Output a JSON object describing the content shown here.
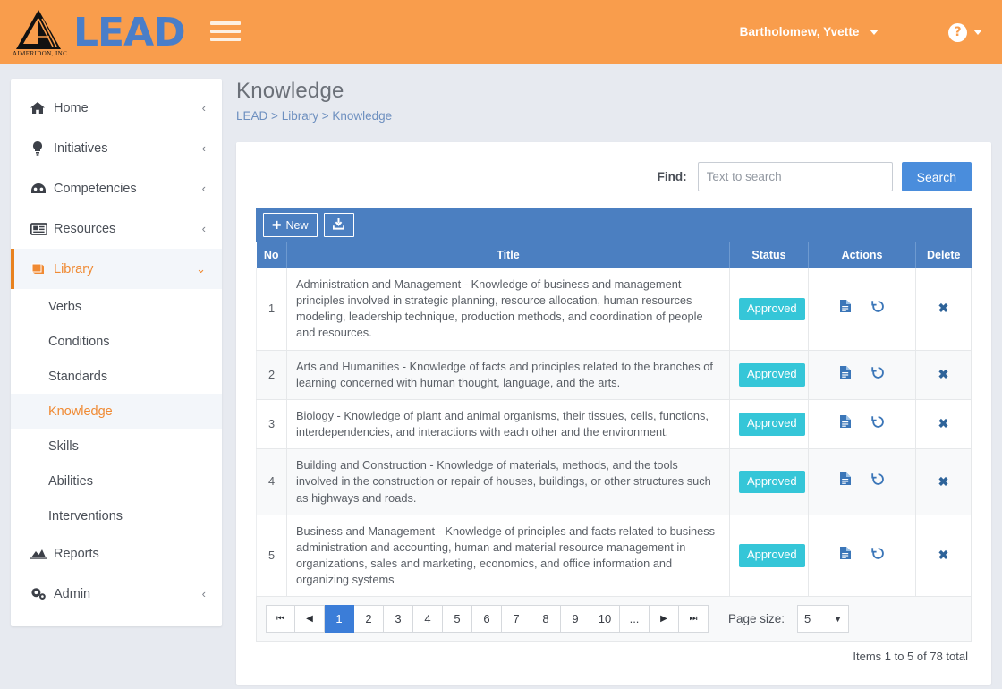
{
  "topbar": {
    "logo_company": "AIMERIDON, INC.",
    "logo_word": "LEAD",
    "menu_icon": "hamburger-icon",
    "user_name": "Bartholomew, Yvette",
    "help_glyph": "?"
  },
  "sidebar": {
    "items": [
      {
        "label": "Home",
        "icon": "home-icon",
        "chev": "‹",
        "active": false
      },
      {
        "label": "Initiatives",
        "icon": "lightbulb-icon",
        "chev": "‹",
        "active": false
      },
      {
        "label": "Competencies",
        "icon": "competency-icon",
        "chev": "‹",
        "active": false
      },
      {
        "label": "Resources",
        "icon": "resources-icon",
        "chev": "‹",
        "active": false
      },
      {
        "label": "Library",
        "icon": "book-icon",
        "chev": "⌄",
        "active": true
      }
    ],
    "sub_items": [
      {
        "label": "Verbs",
        "active": false
      },
      {
        "label": "Conditions",
        "active": false
      },
      {
        "label": "Standards",
        "active": false
      },
      {
        "label": "Knowledge",
        "active": true
      },
      {
        "label": "Skills",
        "active": false
      },
      {
        "label": "Abilities",
        "active": false
      },
      {
        "label": "Interventions",
        "active": false
      }
    ],
    "tail_items": [
      {
        "label": "Reports",
        "icon": "chart-icon",
        "chev": "",
        "active": false
      },
      {
        "label": "Admin",
        "icon": "gears-icon",
        "chev": "‹",
        "active": false
      }
    ]
  },
  "main": {
    "title": "Knowledge",
    "breadcrumb": [
      "LEAD",
      ">",
      "Library",
      ">",
      "Knowledge"
    ]
  },
  "search": {
    "find_label": "Find:",
    "placeholder": "Text to search",
    "value": "",
    "button_label": "Search"
  },
  "toolbar": {
    "new_label": "New",
    "new_icon": "plus-icon",
    "export_icon": "download-icon"
  },
  "table": {
    "columns": [
      "No",
      "Title",
      "Status",
      "Actions",
      "Delete"
    ],
    "rows": [
      {
        "no": "1",
        "title": "Administration and Management - Knowledge of business and management principles involved in strategic planning, resource allocation, human resources modeling, leadership technique, production methods, and coordination of people and resources.",
        "status": "Approved",
        "actions": [
          "document-icon",
          "history-icon"
        ],
        "delete": "✖"
      },
      {
        "no": "2",
        "title": "Arts and Humanities - Knowledge of facts and principles related to the branches of learning concerned with human thought, language, and the arts.",
        "status": "Approved",
        "actions": [
          "document-icon",
          "history-icon"
        ],
        "delete": "✖"
      },
      {
        "no": "3",
        "title": "Biology - Knowledge of plant and animal organisms, their tissues, cells, functions, interdependencies, and interactions with each other and the environment.",
        "status": "Approved",
        "actions": [
          "document-icon",
          "history-icon"
        ],
        "delete": "✖"
      },
      {
        "no": "4",
        "title": "Building and Construction - Knowledge of materials, methods, and the tools involved in the construction or repair of houses, buildings, or other structures such as highways and roads.",
        "status": "Approved",
        "actions": [
          "document-icon",
          "history-icon"
        ],
        "delete": "✖"
      },
      {
        "no": "5",
        "title": "Business and Management - Knowledge of principles and facts related to business administration and accounting, human and material resource management in organizations, sales and marketing, economics, and office information and organizing systems",
        "status": "Approved",
        "actions": [
          "document-icon",
          "history-icon"
        ],
        "delete": "✖"
      }
    ]
  },
  "pagination": {
    "first": "⏮",
    "prev": "◀",
    "pages": [
      "1",
      "2",
      "3",
      "4",
      "5",
      "6",
      "7",
      "8",
      "9",
      "10",
      "..."
    ],
    "current": "1",
    "next": "▶",
    "last": "⏭",
    "page_size_label": "Page size:",
    "page_size_value": "5",
    "totals": "Items 1 to 5 of 78 total"
  },
  "colors": {
    "brand_orange": "#f99d4c",
    "brand_blue": "#4a7ec8",
    "table_header_blue": "#4b7fc1",
    "badge_teal": "#35c6d8",
    "page_bg": "#e7eaf0",
    "active_link": "#f08a33"
  }
}
